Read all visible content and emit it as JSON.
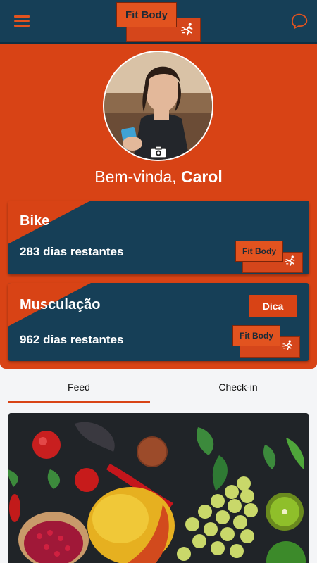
{
  "header": {
    "logo_text": "Fit Body",
    "menu_icon": "hamburger-menu-icon",
    "chat_icon": "chat-bubble-icon"
  },
  "profile": {
    "greeting": "Bem-vinda,",
    "name": "Carol",
    "camera_icon": "camera-icon"
  },
  "cards": [
    {
      "title": "Bike",
      "days": "283 dias restantes",
      "logo_text": "Fit Body"
    },
    {
      "title": "Musculação",
      "days": "962 dias restantes",
      "button": "Dica",
      "logo_text": "Fit Body"
    }
  ],
  "tabs": [
    {
      "label": "Feed",
      "active": true
    },
    {
      "label": "Check-in",
      "active": false
    }
  ],
  "colors": {
    "navy": "#163f57",
    "orange": "#d84315",
    "background": "#f4f5f7"
  }
}
